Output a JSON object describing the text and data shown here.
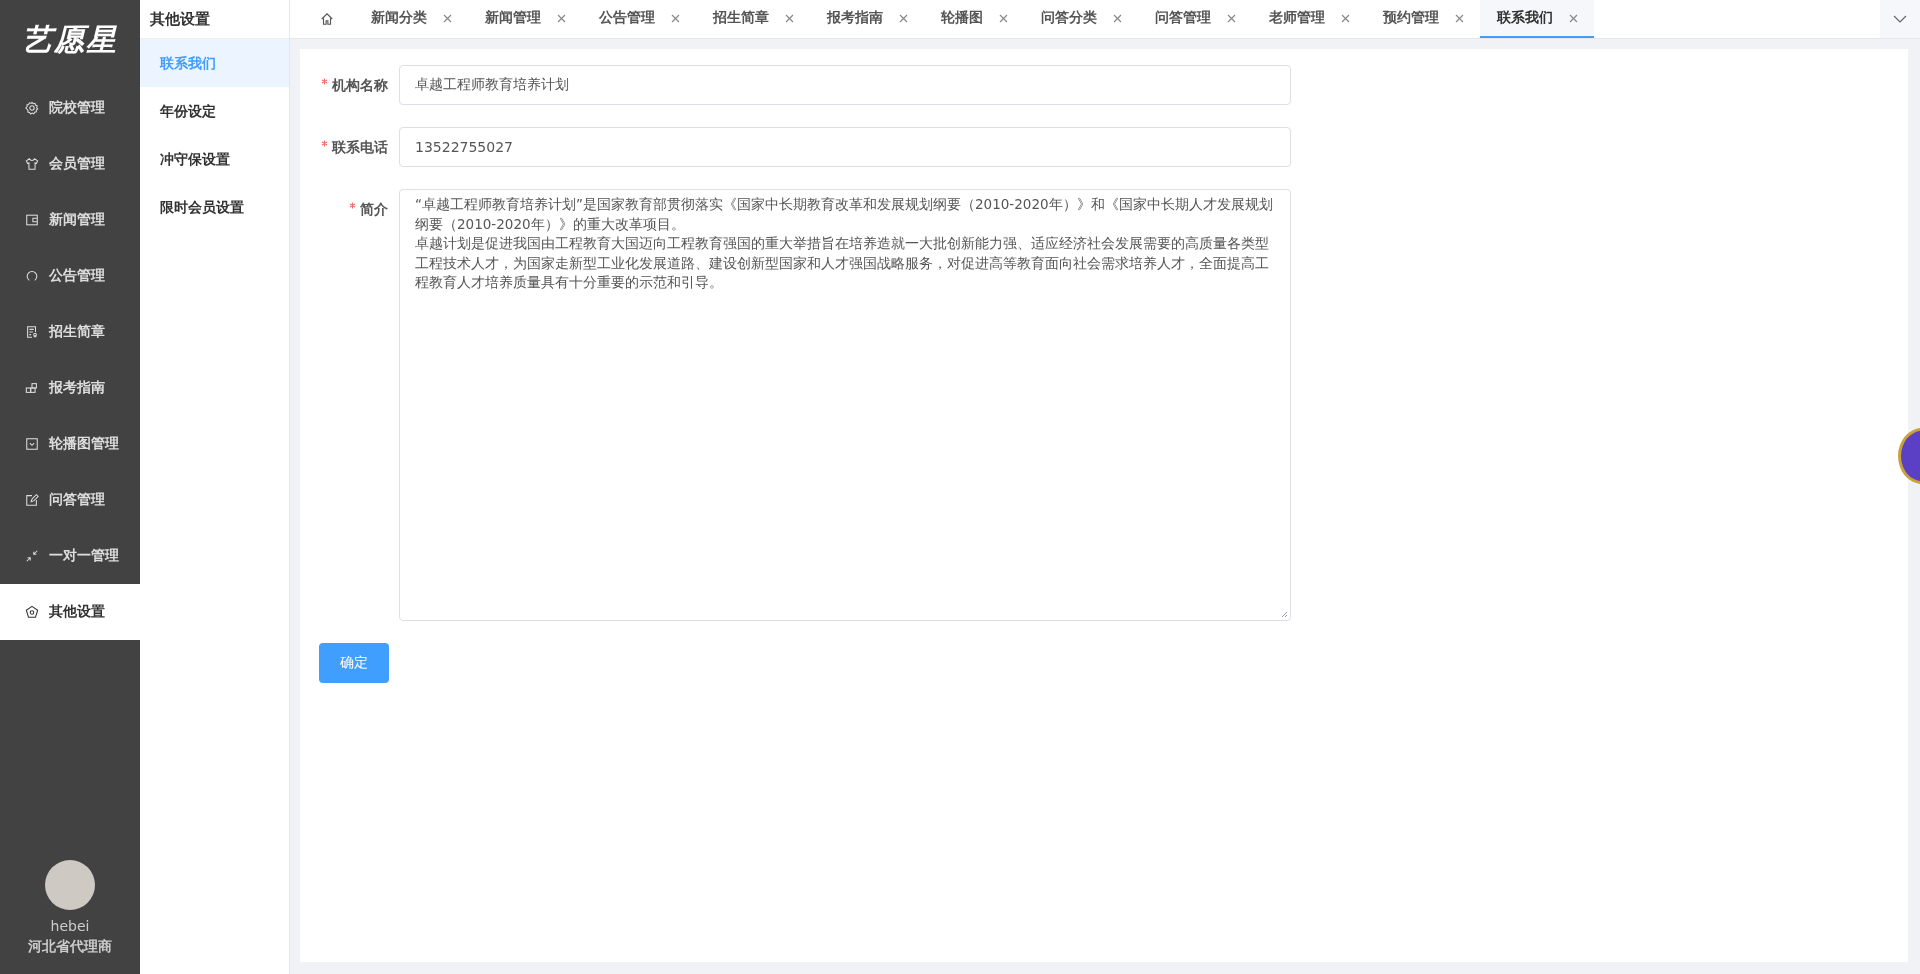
{
  "logo": "艺愿星",
  "sidebar": {
    "items": [
      {
        "label": "院校管理",
        "selected": false
      },
      {
        "label": "会员管理",
        "selected": false
      },
      {
        "label": "新闻管理",
        "selected": false
      },
      {
        "label": "公告管理",
        "selected": false
      },
      {
        "label": "招生简章",
        "selected": false
      },
      {
        "label": "报考指南",
        "selected": false
      },
      {
        "label": "轮播图管理",
        "selected": false
      },
      {
        "label": "问答管理",
        "selected": false
      },
      {
        "label": "一对一管理",
        "selected": false
      },
      {
        "label": "其他设置",
        "selected": true
      }
    ],
    "user": {
      "name": "hebei",
      "role": "河北省代理商"
    }
  },
  "submenu": {
    "title": "其他设置",
    "items": [
      {
        "label": "联系我们",
        "selected": true
      },
      {
        "label": "年份设定",
        "selected": false
      },
      {
        "label": "冲守保设置",
        "selected": false
      },
      {
        "label": "限时会员设置",
        "selected": false
      }
    ]
  },
  "tabs": [
    {
      "label": "新闻分类",
      "selected": false
    },
    {
      "label": "新闻管理",
      "selected": false
    },
    {
      "label": "公告管理",
      "selected": false
    },
    {
      "label": "招生简章",
      "selected": false
    },
    {
      "label": "报考指南",
      "selected": false
    },
    {
      "label": "轮播图",
      "selected": false
    },
    {
      "label": "问答分类",
      "selected": false
    },
    {
      "label": "问答管理",
      "selected": false
    },
    {
      "label": "老师管理",
      "selected": false
    },
    {
      "label": "预约管理",
      "selected": false
    },
    {
      "label": "联系我们",
      "selected": true
    }
  ],
  "form": {
    "fields": [
      {
        "kind": "input",
        "label": "机构名称",
        "required": true,
        "value": "卓越工程师教育培养计划"
      },
      {
        "kind": "input",
        "label": "联系电话",
        "required": true,
        "value": "13522755027"
      },
      {
        "kind": "textarea",
        "label": "简介",
        "required": true,
        "paragraphs": [
          "“卓越工程师教育培养计划”是国家教育部贯彻落实《国家中长期教育改革和发展规划纲要（2010-2020年）》和《国家中长期人才发展规划纲要（2010-2020年）》的重大改革项目。",
          "卓越计划是促进我国由工程教育大国迈向工程教育强国的重大举措旨在培养造就一大批创新能力强、适应经济社会发展需要的高质量各类型工程技术人才，为国家走新型工业化发展道路、建设创新型国家和人才强国战略服务，对促进高等教育面向社会需求培养人才，全面提高工程教育人才培养质量具有十分重要的示范和引导。"
        ]
      }
    ],
    "submit": "确定"
  }
}
